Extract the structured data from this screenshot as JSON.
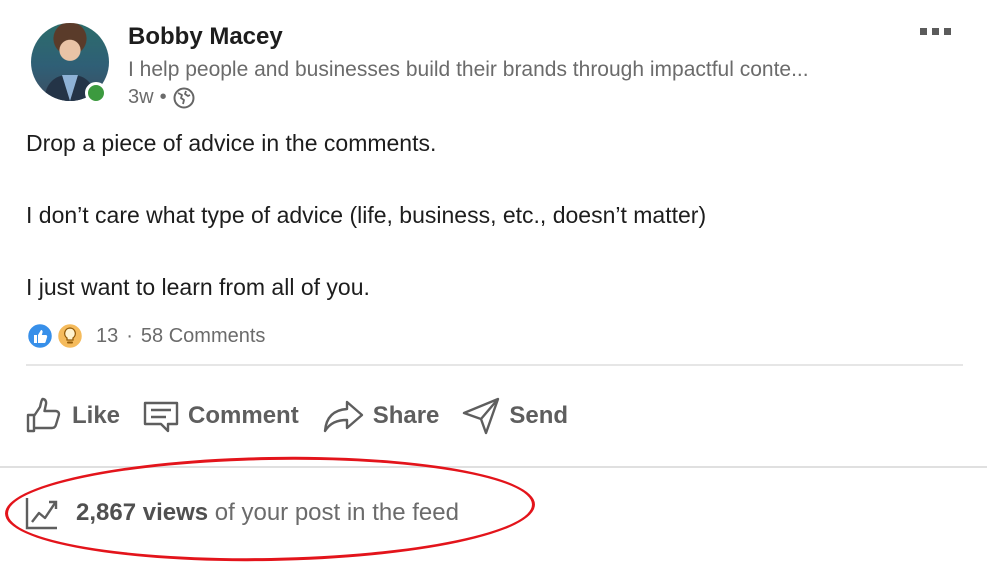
{
  "author": {
    "name": "Bobby Macey",
    "headline": "I help people and businesses build their brands through impactful conte...",
    "time": "3w",
    "separator": "•"
  },
  "post": {
    "lines": [
      "Drop a piece of advice in the comments.",
      "I don’t care what type of advice (life, business, etc., doesn’t matter)",
      "I just want to learn from all of you."
    ]
  },
  "social": {
    "reaction_count": "13",
    "separator": "·",
    "comments": "58 Comments"
  },
  "actions": {
    "like": "Like",
    "comment": "Comment",
    "share": "Share",
    "send": "Send"
  },
  "analytics": {
    "views_count": "2,867 views",
    "views_suffix": "of your post in the feed"
  },
  "colors": {
    "presence": "#3c9a3f",
    "like_reaction": "#0a66c2",
    "insight_reaction": "#f5bb5c",
    "highlight_oval": "#e3141b"
  }
}
